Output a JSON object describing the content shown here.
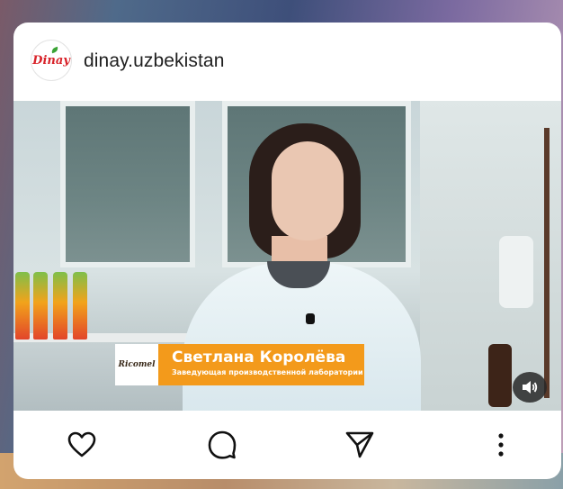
{
  "post": {
    "username": "dinay.uzbekistan",
    "avatar_text": "Dinay"
  },
  "video": {
    "lower_third": {
      "brand": "Ricomel",
      "name": "Светлана Королёва",
      "title": "Заведующая производственной лаборатории"
    },
    "volume_icon": "speaker-volume-icon"
  },
  "actions": {
    "like_icon": "heart-icon",
    "comment_icon": "comment-icon",
    "share_icon": "send-icon",
    "more_icon": "more-vertical-icon"
  },
  "colors": {
    "accent_orange": "#f39a1b",
    "card_background": "#ffffff",
    "text": "#1f1f1f"
  }
}
